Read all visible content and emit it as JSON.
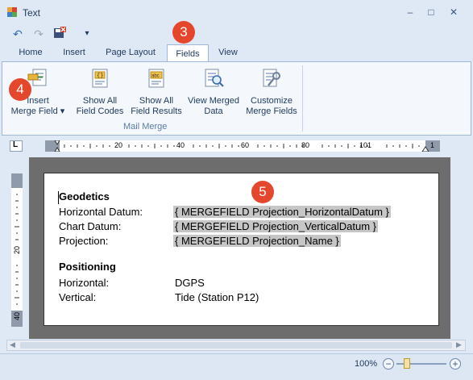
{
  "window": {
    "title": "Text"
  },
  "quick_access": {
    "undo": "↶",
    "redo": "↷",
    "save": "💾",
    "customize": "▾"
  },
  "tabs": [
    {
      "label": "Home"
    },
    {
      "label": "Insert"
    },
    {
      "label": "Page Layout"
    },
    {
      "label": "Fields"
    },
    {
      "label": "View"
    }
  ],
  "ribbon": {
    "buttons": [
      {
        "label": "Insert\nMerge Field"
      },
      {
        "label": "Show All\nField Codes"
      },
      {
        "label": "Show All\nField Results"
      },
      {
        "label": "View Merged\nData"
      },
      {
        "label": "Customize\nMerge Fields"
      }
    ],
    "group_label": "Mail Merge",
    "dropdown_glyph": "▾"
  },
  "ruler": {
    "h_ticks": [
      "20",
      "40",
      "60",
      "80",
      "101",
      "1"
    ],
    "v_ticks": [
      "20",
      "40"
    ],
    "corner": "L"
  },
  "document": {
    "heading1": "Geodetics",
    "rows1": [
      {
        "label": "Horizontal Datum:",
        "value": "{ MERGEFIELD Projection_HorizontalDatum }"
      },
      {
        "label": "Chart Datum:",
        "value": "{ MERGEFIELD Projection_VerticalDatum }"
      },
      {
        "label": "Projection:",
        "value": "{ MERGEFIELD Projection_Name }"
      }
    ],
    "heading2": "Positioning",
    "rows2": [
      {
        "label": "Horizontal:",
        "value": "DGPS"
      },
      {
        "label": "Vertical:",
        "value": "Tide (Station P12)"
      }
    ]
  },
  "status": {
    "zoom": "100%",
    "zoom_out": "−",
    "zoom_in": "+"
  },
  "badges": [
    "3",
    "4",
    "5"
  ],
  "colors": {
    "accent": "#e4472b",
    "field_bg": "#c6c6c6",
    "frame": "#dfe9f5"
  }
}
